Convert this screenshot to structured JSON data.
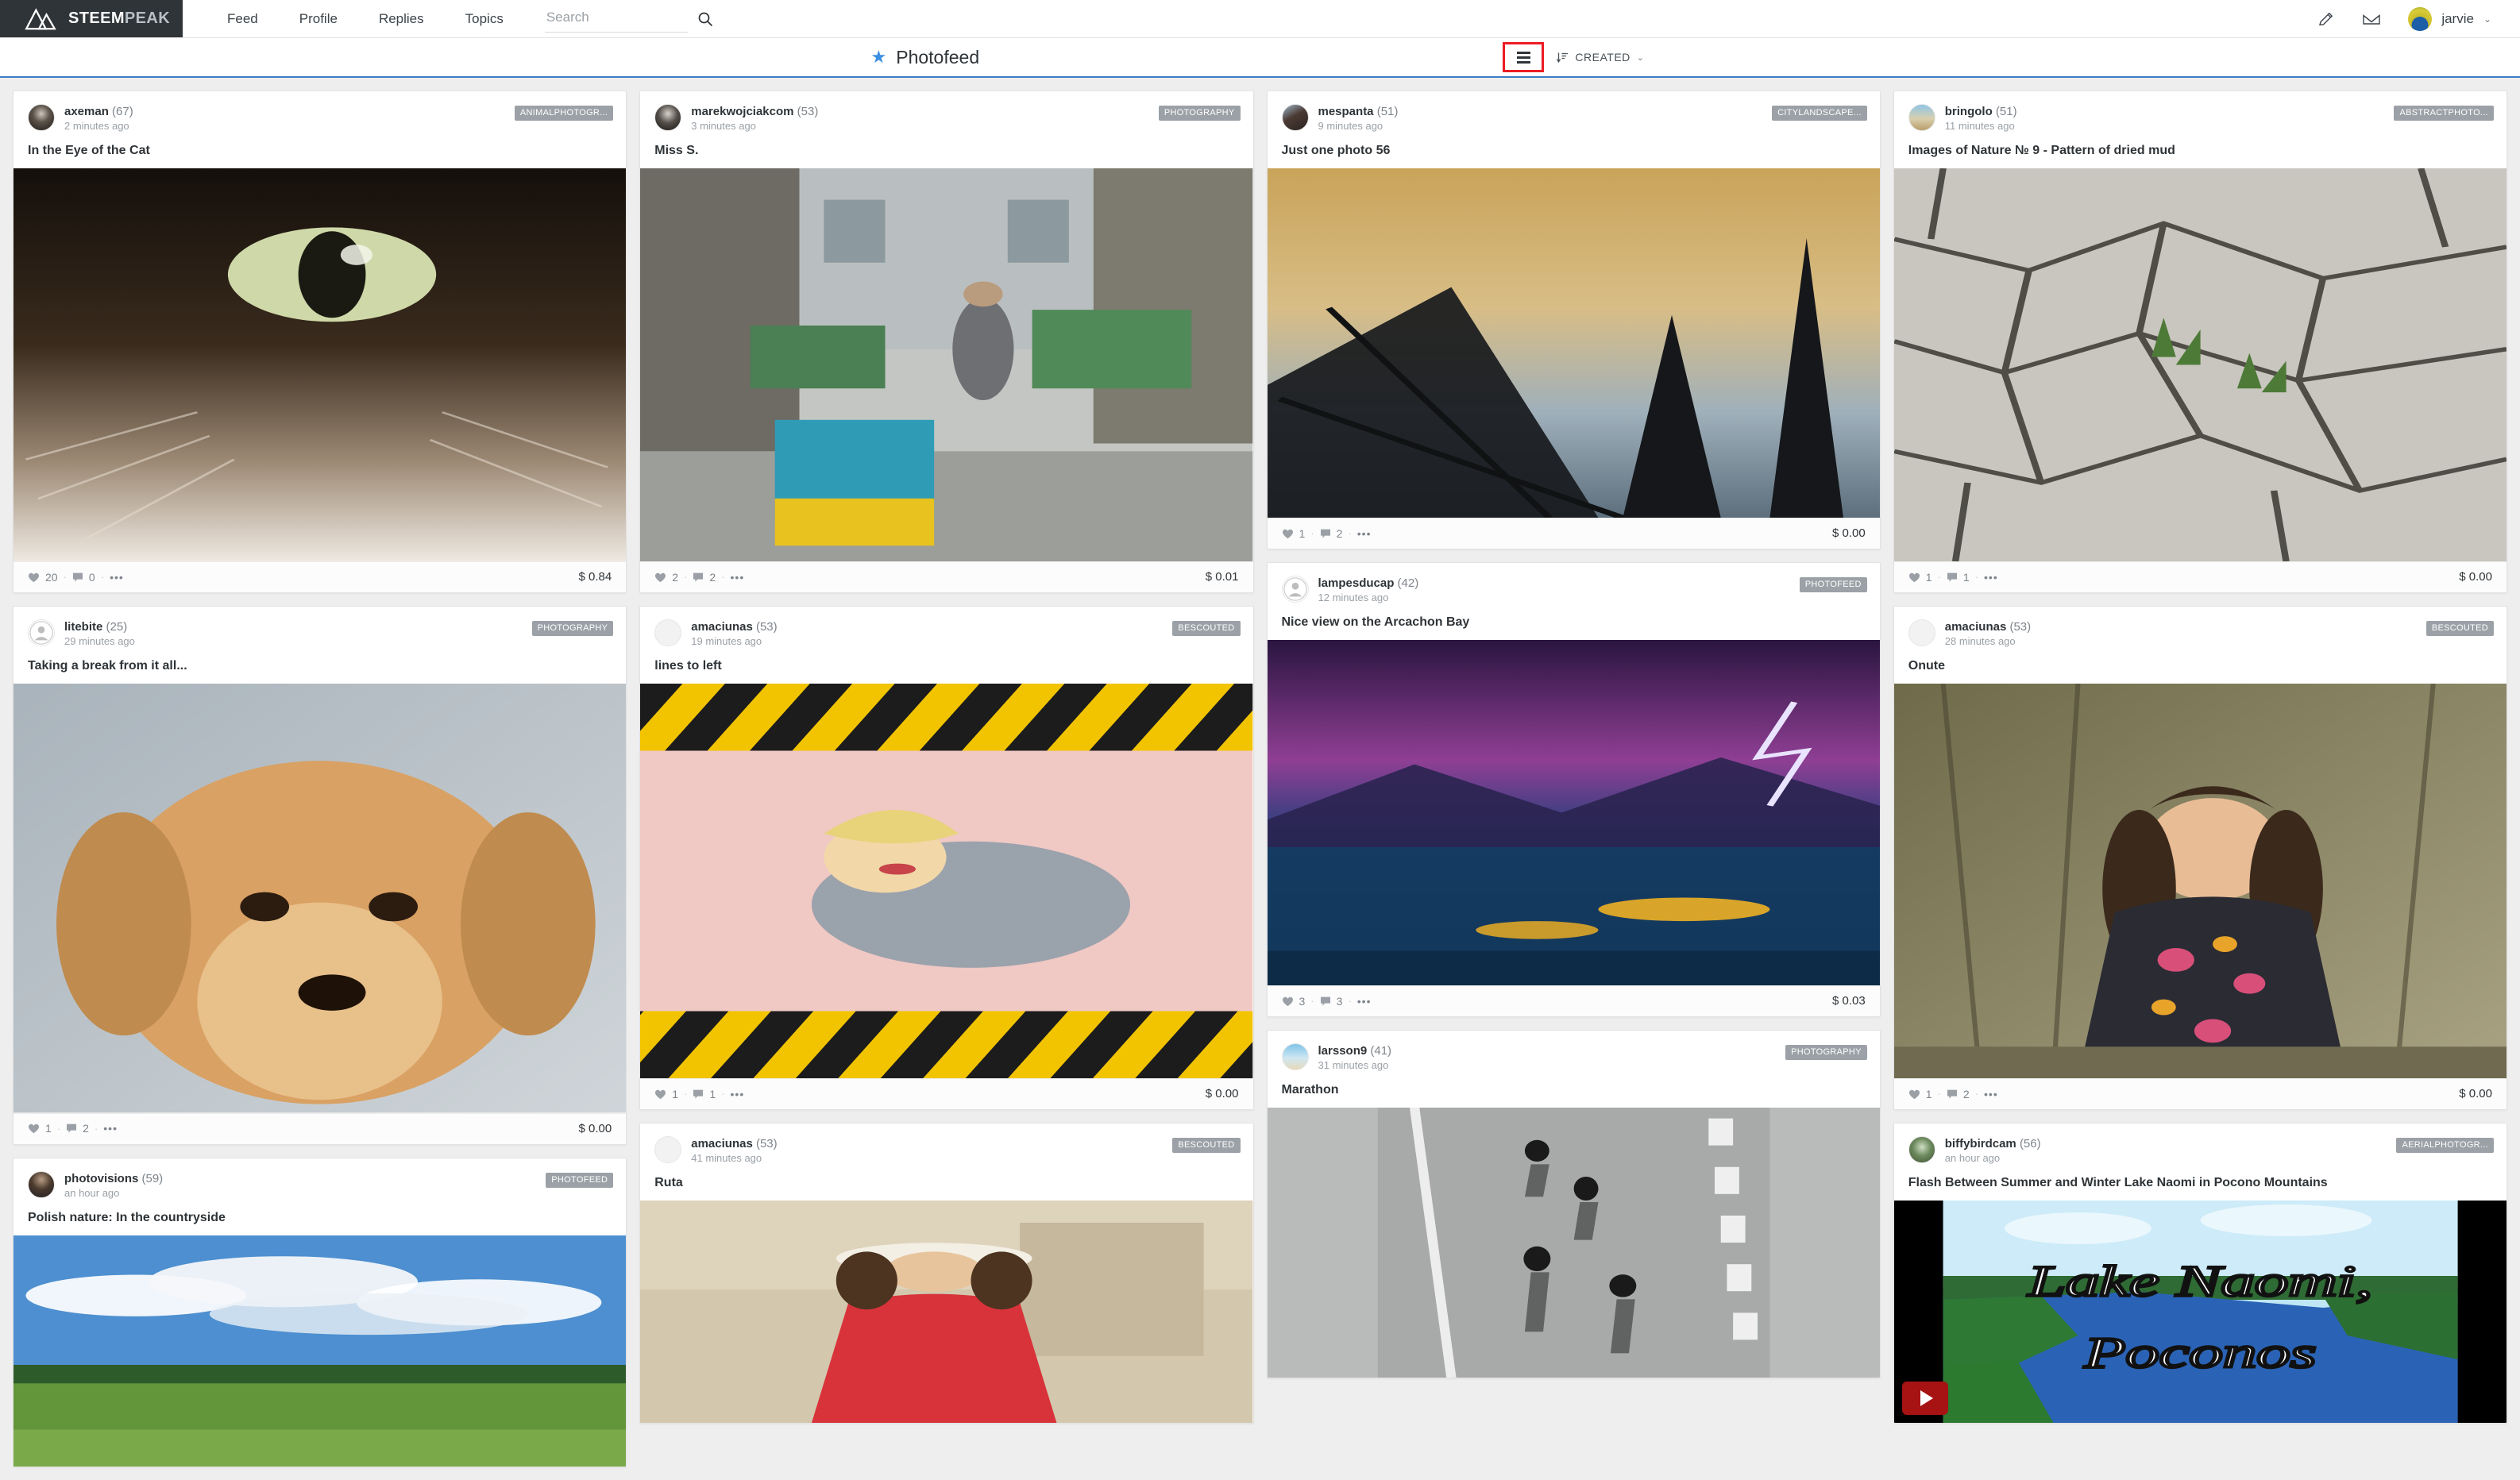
{
  "header": {
    "brand_bold": "STEEM",
    "brand_light": "PEAK",
    "nav": [
      {
        "label": "Feed",
        "name": "nav-feed"
      },
      {
        "label": "Profile",
        "name": "nav-profile"
      },
      {
        "label": "Replies",
        "name": "nav-replies"
      },
      {
        "label": "Topics",
        "name": "nav-topics"
      }
    ],
    "search": {
      "value": "",
      "placeholder": "Search"
    },
    "user": {
      "name": "jarvie",
      "caret": "⌄"
    }
  },
  "feedbar": {
    "star": "★",
    "title": "Photofeed",
    "view_toggle_name": "list-view-toggle",
    "sort_label": "CREATED",
    "sort_caret": "⌄",
    "highlight_color": "#ec1c24",
    "accent_color": "#3b7cc4"
  },
  "columns": [
    {
      "cards": [
        {
          "author": "axeman",
          "rep": "(67)",
          "ago": "2 minutes ago",
          "tag": "ANIMALPHOTOGR...",
          "title": "In the Eye of the Cat",
          "likes": "20",
          "comments": "0",
          "more": "•••",
          "payout": "$ 0.84",
          "media_height": 510,
          "media_kind": "image-cat"
        },
        {
          "author": "litebite",
          "rep": "(25)",
          "ago": "29 minutes ago",
          "tag": "PHOTOGRAPHY",
          "title": "Taking a break from it all...",
          "likes": "1",
          "comments": "2",
          "more": "•••",
          "payout": "$ 0.00",
          "media_height": 556,
          "media_kind": "image-dog"
        },
        {
          "author": "photovisions",
          "rep": "(59)",
          "ago": "an hour ago",
          "tag": "PHOTOFEED",
          "title": "Polish nature: In the countryside",
          "likes": "",
          "comments": "",
          "more": "",
          "payout": "",
          "media_height": 300,
          "media_kind": "image-countryside"
        }
      ]
    },
    {
      "cards": [
        {
          "author": "marekwojciakcom",
          "rep": "(53)",
          "ago": "3 minutes ago",
          "tag": "PHOTOGRAPHY",
          "title": "Miss S.",
          "likes": "2",
          "comments": "2",
          "more": "•••",
          "payout": "$ 0.01",
          "media_height": 495,
          "media_kind": "image-street"
        },
        {
          "author": "amaciunas",
          "rep": "(53)",
          "ago": "19 minutes ago",
          "tag": "BESCOUTED",
          "title": "lines to left",
          "likes": "1",
          "comments": "1",
          "more": "•••",
          "payout": "$ 0.00",
          "media_height": 497,
          "media_kind": "image-hazard"
        },
        {
          "author": "amaciunas",
          "rep": "(53)",
          "ago": "41 minutes ago",
          "tag": "BESCOUTED",
          "title": "Ruta",
          "likes": "",
          "comments": "",
          "more": "",
          "payout": "",
          "media_height": 280,
          "media_kind": "image-redlady"
        }
      ]
    },
    {
      "cards": [
        {
          "author": "mespanta",
          "rep": "(51)",
          "ago": "9 minutes ago",
          "tag": "CITYLANDSCAPE...",
          "title": "Just one photo 56",
          "likes": "1",
          "comments": "2",
          "more": "•••",
          "payout": "$ 0.00",
          "media_height": 440,
          "media_kind": "image-sunset"
        },
        {
          "author": "lampesducap",
          "rep": "(42)",
          "ago": "12 minutes ago",
          "tag": "PHOTOFEED",
          "title": "Nice view on the Arcachon Bay",
          "likes": "3",
          "comments": "3",
          "more": "•••",
          "payout": "$ 0.03",
          "media_height": 435,
          "media_kind": "image-bay"
        },
        {
          "author": "larsson9",
          "rep": "(41)",
          "ago": "31 minutes ago",
          "tag": "PHOTOGRAPHY",
          "title": "Marathon",
          "likes": "",
          "comments": "",
          "more": "",
          "payout": "",
          "media_height": 340,
          "media_kind": "image-marathon"
        }
      ]
    },
    {
      "cards": [
        {
          "author": "bringolo",
          "rep": "(51)",
          "ago": "11 minutes ago",
          "tag": "ABSTRACTPHOTO...",
          "title": "Images of Nature № 9 - Pattern of dried mud",
          "likes": "1",
          "comments": "1",
          "more": "•••",
          "payout": "$ 0.00",
          "media_height": 495,
          "media_kind": "image-mud"
        },
        {
          "author": "amaciunas",
          "rep": "(53)",
          "ago": "28 minutes ago",
          "tag": "BESCOUTED",
          "title": "Onute",
          "likes": "1",
          "comments": "2",
          "more": "•••",
          "payout": "$ 0.00",
          "media_height": 497,
          "media_kind": "image-portrait"
        },
        {
          "author": "biffybirdcam",
          "rep": "(56)",
          "ago": "an hour ago",
          "tag": "AERIALPHOTOGR...",
          "title": "Flash Between Summer and Winter Lake Naomi in Pocono Mountains",
          "likes": "",
          "comments": "",
          "more": "",
          "payout": "",
          "media_height": 280,
          "media_kind": "video-lakenaomi",
          "video_line1": "Lake Naomi,",
          "video_line2": "Poconos"
        }
      ]
    }
  ]
}
